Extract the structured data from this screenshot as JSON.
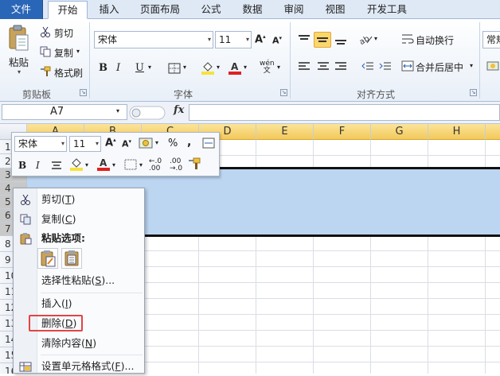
{
  "ribbon_tabs": [
    "文件",
    "开始",
    "插入",
    "页面布局",
    "公式",
    "数据",
    "审阅",
    "视图",
    "开发工具"
  ],
  "clipboard": {
    "paste": "粘贴",
    "cut": "剪切",
    "copy": "复制",
    "format_painter": "格式刷",
    "group_label": "剪贴板"
  },
  "font": {
    "name": "宋体",
    "size": "11",
    "bold": "B",
    "italic": "I",
    "underline": "U",
    "group_label": "字体",
    "font_color": "#e02020",
    "fill_color": "#f7e33a"
  },
  "alignment": {
    "wrap_text": "自动换行",
    "merge_center": "合并后居中",
    "group_label": "对齐方式"
  },
  "number": {
    "format": "常规"
  },
  "formula_bar": {
    "name_box": "A7",
    "fx": "fx",
    "value": ""
  },
  "columns": [
    "A",
    "B",
    "C",
    "D",
    "E",
    "F",
    "G",
    "H"
  ],
  "highlighted_columns": [
    "A",
    "B",
    "C",
    "D",
    "E",
    "F",
    "G",
    "H"
  ],
  "rows": [
    "1",
    "2",
    "3",
    "4",
    "5",
    "6",
    "7",
    "8",
    "9",
    "10",
    "11",
    "12",
    "13",
    "14",
    "15",
    "16"
  ],
  "selected_rows": [
    "3",
    "4",
    "5",
    "6",
    "7"
  ],
  "mini_toolbar": {
    "font": "宋体",
    "size": "11",
    "percent": "%",
    "comma": ","
  },
  "context_menu": {
    "items": [
      {
        "label": "剪切",
        "key": "T",
        "icon": "scissors-icon"
      },
      {
        "label": "复制",
        "key": "C",
        "icon": "copy-icon"
      },
      {
        "label": "粘贴选项:",
        "icon": "clipboard-icon",
        "heading": true
      },
      {
        "label": "选择性粘贴",
        "key": "S",
        "suffix": "..."
      },
      {
        "label": "插入",
        "key": "I"
      },
      {
        "label": "删除",
        "key": "D",
        "highlighted": true
      },
      {
        "label": "清除内容",
        "key": "N"
      },
      {
        "label": "设置单元格格式",
        "key": "F",
        "suffix": "...",
        "icon": "format-cells-icon"
      }
    ]
  },
  "colors": {
    "file_tab": "#2a66b8",
    "selection": "#bcd6f2",
    "highlight_header": "#f3c95a",
    "delete_box": "#e24444"
  }
}
